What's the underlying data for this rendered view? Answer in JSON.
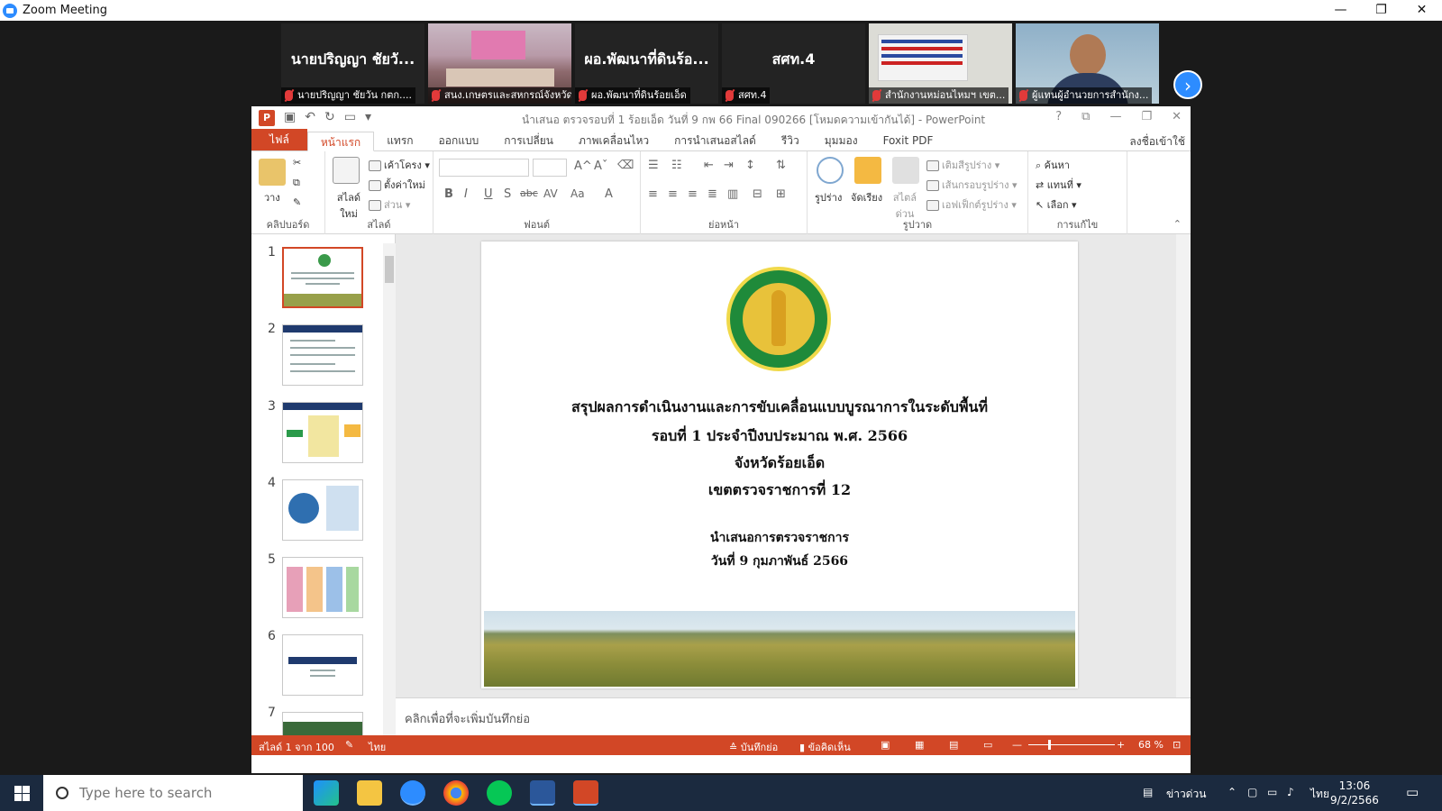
{
  "zoom": {
    "title": "Zoom Meeting",
    "minimize": "—",
    "restore": "❐",
    "close": "✕",
    "participants": [
      {
        "name": "นายปริญญา ชัยวั...",
        "caption": "นายปริญญา ชัยวัน กตก...."
      },
      {
        "name": "",
        "caption": "สนง.เกษตรและสหกรณ์จังหวัด..."
      },
      {
        "name": "ผอ.พัฒนาที่ดินร้อ...",
        "caption": "ผอ.พัฒนาที่ดินร้อยเอ็ด"
      },
      {
        "name": "สศท.4",
        "caption": "สศท.4"
      },
      {
        "name": "",
        "caption": "สำนักงานหม่อนไหมฯ เขต..."
      },
      {
        "name": "",
        "caption": "ผู้แทนผู้อำนวยการสำนักง..."
      }
    ],
    "next": "›"
  },
  "ppt": {
    "window_title": "นำเสนอ ตรวจรอบที่ 1 ร้อยเอ็ด วันที่ 9 กพ 66 Final 090266 [โหมดความเข้ากันได้] - PowerPoint",
    "window_controls": [
      "?",
      "⧉",
      "—",
      "❐",
      "✕"
    ],
    "tabs": [
      "ไฟล์",
      "หน้าแรก",
      "แทรก",
      "ออกแบบ",
      "การเปลี่ยน",
      "ภาพเคลื่อนไหว",
      "การนำเสนอสไลด์",
      "รีวิว",
      "มุมมอง",
      "Foxit PDF"
    ],
    "signin": "ลงชื่อเข้าใช้",
    "ribbon": {
      "clipboard": {
        "label": "คลิปบอร์ด",
        "paste": "วาง"
      },
      "slides": {
        "label": "สไลด์",
        "new_slide": "สไลด์ใหม่",
        "layout": "เค้าโครง",
        "reset": "ตั้งค่าใหม่",
        "section": "ส่วน"
      },
      "font": {
        "label": "ฟอนต์",
        "bold": "B",
        "italic": "I",
        "underline": "U",
        "shadow": "S",
        "strike": "abc",
        "spacing": "AV",
        "case": "Aa",
        "color": "A",
        "grow": "A^",
        "shrink": "Aˇ"
      },
      "paragraph": {
        "label": "ย่อหน้า"
      },
      "drawing": {
        "label": "รูปวาด",
        "shapes": "รูปร่าง",
        "arrange": "จัดเรียง",
        "quick_styles": "สไตล์ด่วน",
        "fill": "เติมสีรูปร่าง",
        "outline": "เส้นกรอบรูปร่าง",
        "effects": "เอฟเฟ็กต์รูปร่าง"
      },
      "editing": {
        "label": "การแก้ไข",
        "find": "ค้นหา",
        "replace": "แทนที่",
        "select": "เลือก"
      }
    },
    "thumbnails": [
      "1",
      "2",
      "3",
      "4",
      "5",
      "6",
      "7"
    ],
    "slide": {
      "line1": "สรุปผลการดำเนินงานและการขับเคลื่อนแบบบูรณาการในระดับพื้นที่",
      "line2": "รอบที่ 1 ประจำปีงบประมาณ พ.ศ. 2566",
      "line3": "จังหวัดร้อยเอ็ด",
      "line4": "เขตตรวจราชการที่ 12",
      "line5": "นำเสนอการตรวจราชการ",
      "line6": "วันที่ 9 กุมภาพันธ์ 2566"
    },
    "notes_placeholder": "คลิกเพื่อที่จะเพิ่มบันทึกย่อ",
    "status": {
      "slide_count": "สไลด์ 1 จาก 100",
      "language": "ไทย",
      "notes": "บันทึกย่อ",
      "comments": "ข้อคิดเห็น",
      "zoom": "68 %"
    }
  },
  "taskbar": {
    "search_placeholder": "Type here to search",
    "news": "ข่าวด่วน",
    "language": "ไทย",
    "time": "13:06",
    "date": "9/2/2566"
  },
  "colors": {
    "accent": "#d24726",
    "zoom_blue": "#2d8cff",
    "taskbar": "#1b2a3f"
  }
}
